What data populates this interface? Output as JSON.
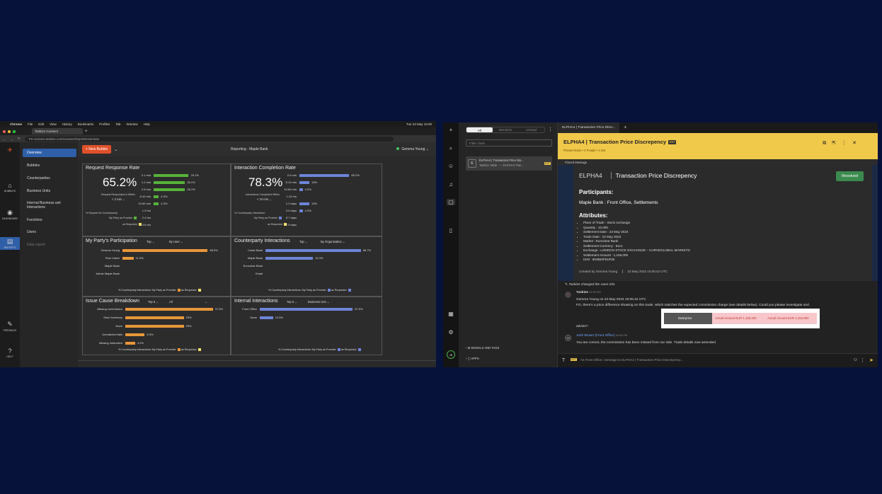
{
  "left": {
    "mac_menu": [
      "Chrome",
      "File",
      "Edit",
      "View",
      "History",
      "Bookmarks",
      "Profiles",
      "Tab",
      "Window",
      "Help"
    ],
    "mac_clock": "Tue 23 May 16:00",
    "browser_tab": "Taskize Connect",
    "url": "P2-connect.taskize.com/connect/reports/overview",
    "rail": [
      {
        "label": "BUBBLES",
        "icon": "home-icon"
      },
      {
        "label": "DASHBOARD",
        "icon": "dashboard-icon"
      },
      {
        "label": "REPORTS",
        "icon": "reports-icon"
      },
      {
        "label": "FEEDBACK",
        "icon": "feedback-icon"
      },
      {
        "label": "HELP",
        "icon": "help-icon"
      }
    ],
    "nav": [
      "Overview",
      "Bubbles",
      "Counterparties",
      "Business Units",
      "Internal Business unit Interactions",
      "Functions",
      "Users",
      "Data export"
    ],
    "new_bubble": "+ New Bubble",
    "title": "Reporting - Maple Bank",
    "user": "Gemma Young",
    "panels": {
      "response": {
        "title": "Request Response Rate",
        "big": "65.2%",
        "sub": "Request Responded to Within",
        "dd": "< 2 min",
        "cp": "% Request for Counterparty:",
        "prov": "My Party as Provider",
        "req": "as Requestor",
        "rows": [
          {
            "l": "0.1 min",
            "v": "29.1%",
            "f": 0.291
          },
          {
            "l": "1.2 min",
            "v": "26.1%",
            "f": 0.261
          },
          {
            "l": "2.5 min",
            "v": "26.1%",
            "f": 0.261
          },
          {
            "l": "8.10 min",
            "v": "4.3%",
            "f": 0.043
          },
          {
            "l": "10.60 min",
            "v": "4.3%",
            "f": 0.043
          },
          {
            "l": "1.3 hrs",
            "v": "",
            "f": 0
          },
          {
            "l": "2.4 hrs",
            "v": "",
            "f": 0
          },
          {
            "l": "4.6 hrs",
            "v": "",
            "f": 0
          }
        ]
      },
      "completion": {
        "title": "Interaction Completion Rate",
        "big": "78.3%",
        "sub": "Interactions Completed Within",
        "dd": "< 10 min",
        "cp": "% Counterparty Interaction:",
        "prov": "My Party as Provider",
        "req": "as Requestor",
        "rows": [
          {
            "l": "0.5 min",
            "v": "65.2%",
            "f": 0.652
          },
          {
            "l": "5.10 min",
            "v": "13%",
            "f": 0.13
          },
          {
            "l": "10.60 min",
            "v": "4.3%",
            "f": 0.043
          },
          {
            "l": "1.24 hrs",
            "v": "",
            "f": 0
          },
          {
            "l": "1.3 days",
            "v": "13%",
            "f": 0.13
          },
          {
            "l": "3.5 days",
            "v": "4.3%",
            "f": 0.043
          },
          {
            "l": "5.7 days",
            "v": "",
            "f": 0
          },
          {
            "l": "7.9 days",
            "v": "",
            "f": 0
          }
        ]
      },
      "participation": {
        "title": "My Party's Participation",
        "dd1": "Top",
        "dd2": "By User",
        "rows": [
          {
            "l": "Gemma Young",
            "v": "88.5%",
            "f": 0.885
          },
          {
            "l": "Paul Carter",
            "v": "11.5%",
            "f": 0.115
          },
          {
            "l": "Maple Bank",
            "v": "",
            "f": 0
          },
          {
            "l": "Admin Maple Bank",
            "v": "",
            "f": 0
          }
        ],
        "foot": "% Counterparty interactions: My Party as Provider",
        "foot2": "as Requestor"
      },
      "counterparty": {
        "title": "Counterparty Interactions",
        "dd1": "Top",
        "dd2": "By Organisation",
        "rows": [
          {
            "l": "Cedar Bank",
            "v": "66.7%",
            "f": 0.667
          },
          {
            "l": "Maple Bank",
            "v": "33.3%",
            "f": 0.333
          },
          {
            "l": "Euroclear Bank",
            "v": "",
            "f": 0
          },
          {
            "l": "Email",
            "v": "",
            "f": 0
          }
        ],
        "foot": "% Counterparty interactions: My Party as Provider",
        "foot2": "as Requestor"
      },
      "issue": {
        "title": "Issue Cause Breakdown",
        "dd1": "Top 5",
        "dd2": "All",
        "rows": [
          {
            "l": "Missing commission",
            "v": "37.5%",
            "f": 0.375
          },
          {
            "l": "Short inventory",
            "v": "25%",
            "f": 0.25
          },
          {
            "l": "None",
            "v": "25%",
            "f": 0.25
          },
          {
            "l": "Unmatched fails",
            "v": "8.3%",
            "f": 0.083
          },
          {
            "l": "Missing instruction",
            "v": "4.2%",
            "f": 0.042
          }
        ],
        "foot": "% Counterparty interactions: My Party as Provider",
        "foot2": "as Requestor"
      },
      "internal": {
        "title": "Internal Interactions",
        "dd1": "Top 5",
        "dd2": "Business Unit",
        "rows": [
          {
            "l": "Front Office",
            "v": "87.5%",
            "f": 0.875
          },
          {
            "l": "None",
            "v": "12.5%",
            "f": 0.125
          }
        ],
        "foot": "% Counterparty interactions: My Party as Provider",
        "foot2": "as Requestor"
      }
    },
    "colors": {
      "green": "#57b23a",
      "orange": "#e8973a",
      "yellow": "#f2df6a",
      "blue": "#6d84d8"
    }
  },
  "right": {
    "rail_icons": [
      "plus-icon",
      "search-icon",
      "contacts-icon",
      "bell-icon",
      "chat-icon",
      "bookmark-icon",
      "apps-icon",
      "settings-icon"
    ],
    "avatar": "JB",
    "seg": [
      "All",
      "Mentions",
      "Unread"
    ],
    "filter_placeholder": "Filter chats",
    "chat_item": {
      "line1": "ELPHA4 | Transaction Price Dis...",
      "line2": "Taskize Table : --- ELPHA4 Tran...",
      "badge": "EXT",
      "av": "E"
    },
    "signals": "SIGNALS AND TAGS",
    "apps": "APPS",
    "tab": "ELPHA4 | Transaction Price Discr...",
    "room_title": "ELPHA4 | Transaction Price Discrepency",
    "ext": "EXT",
    "room_sub": "Private Room  •  2 People  •  1 Bot",
    "pinned": "Pinned Message",
    "card": {
      "code": "ELPHA4",
      "title": "Transaction Price Discrepency",
      "resolved": "Resolved",
      "participants_h": "Participants:",
      "participants": "Maple Bank : Front Office, Settlements",
      "attributes_h": "Attributes:",
      "attrs": [
        "Place of Trade : Stock exchange",
        "Quantity : 10,000",
        "Settlement Date : 23 May 2023",
        "Trade Date : 22 May 2023",
        "Market : Euroclear Bank",
        "Settlement Currency : Euro",
        "Exchange : LONDON STOCK EXCHANGE – CURVEGLOBAL MARKETS",
        "Settlement Amount : 1,155,000",
        "ISIN : IE00B3F81R35"
      ],
      "created_by": "Created by Gemma Young",
      "created_at": "23 May 2023 15:05:42 UTC"
    },
    "event": "Taskize changed the room info",
    "msg1": {
      "author": "Taskize",
      "time": "04:05 PM",
      "l1": "Gemma Young on 23 May 2023 15:05:42 UTC",
      "l2": "FO, there's a price difference showing on this trade, which matches the expected commission charge (see details below). Could you please investigate and",
      "l3": "advise?"
    },
    "deal": {
      "h": "Deal price",
      "a": "Actual Amount EUR 1,155,000",
      "b": "Actual Amount EUR 1,154,990"
    },
    "msg2": {
      "author": "Josh Brown",
      "org": "(Front Office)",
      "time": "04:06 PM",
      "av": "JB",
      "text": "You are correct, the commission has been missed from our side. Trade details now amended"
    },
    "composer": "As Front Office, message to ELPHA4 | Transaction Price Discrepency..."
  }
}
